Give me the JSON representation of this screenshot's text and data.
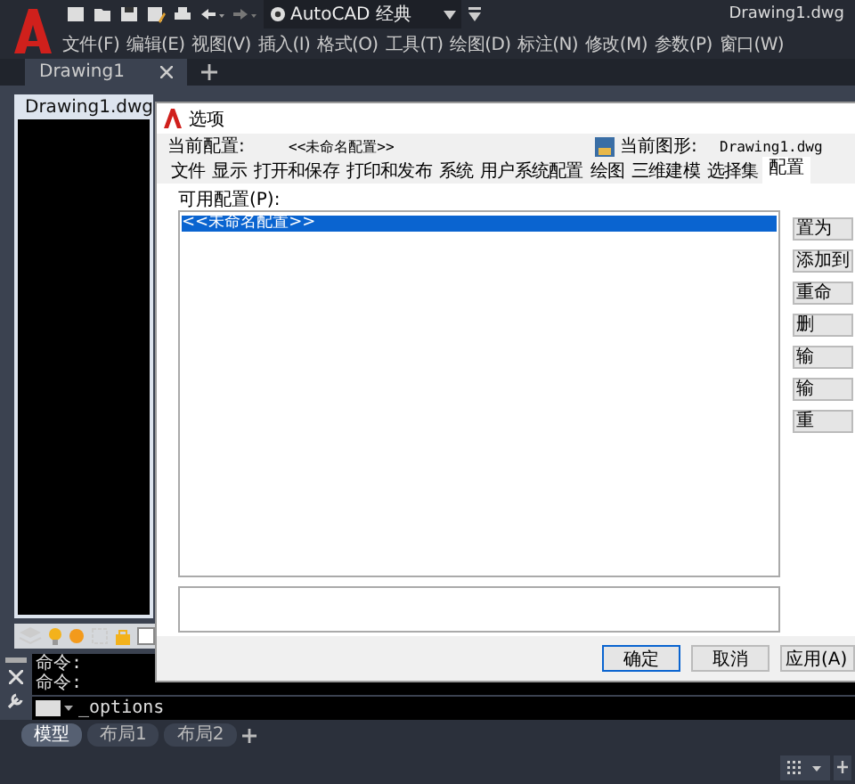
{
  "app": {
    "title": "Drawing1.dwg",
    "workspace": "AutoCAD 经典"
  },
  "menu": [
    "文件(F)",
    "编辑(E)",
    "视图(V)",
    "插入(I)",
    "格式(O)",
    "工具(T)",
    "绘图(D)",
    "标注(N)",
    "修改(M)",
    "参数(P)",
    "窗口(W)"
  ],
  "doc_tabs": [
    {
      "label": "Drawing1",
      "selected": true
    }
  ],
  "drawing_window": {
    "title": "Drawing1.dwg"
  },
  "command_history": [
    "命令:",
    "命令:"
  ],
  "command_input": "_options",
  "layout_tabs": [
    {
      "label": "模型",
      "selected": true
    },
    {
      "label": "布局1",
      "selected": false
    },
    {
      "label": "布局2",
      "selected": false
    }
  ],
  "dialog": {
    "title": "选项",
    "current_profile_label": "当前配置:",
    "current_profile": "<<未命名配置>>",
    "current_drawing_label": "当前图形:",
    "current_drawing": "Drawing1.dwg",
    "tabs": [
      {
        "label": "文件",
        "selected": false
      },
      {
        "label": "显示",
        "selected": false
      },
      {
        "label": "打开和保存",
        "selected": false
      },
      {
        "label": "打印和发布",
        "selected": false
      },
      {
        "label": "系统",
        "selected": false
      },
      {
        "label": "用户系统配置",
        "selected": false
      },
      {
        "label": "绘图",
        "selected": false
      },
      {
        "label": "三维建模",
        "selected": false
      },
      {
        "label": "选择集",
        "selected": false
      },
      {
        "label": "配置",
        "selected": true
      }
    ],
    "list_label": "可用配置(P):",
    "profiles": [
      {
        "label": "<<未命名配置>>",
        "selected": true
      }
    ],
    "side_buttons": [
      "置为",
      "添加到",
      "重命",
      "删",
      "输",
      "输",
      "重"
    ],
    "buttons": [
      {
        "label": "确定",
        "default": true
      },
      {
        "label": "取消",
        "default": false
      },
      {
        "label": "应用(A)",
        "default": false
      }
    ]
  }
}
